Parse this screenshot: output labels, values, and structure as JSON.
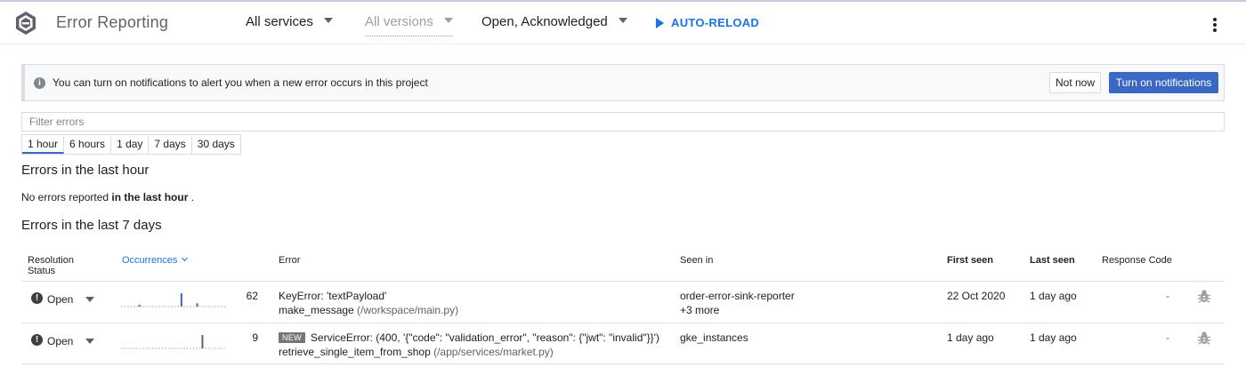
{
  "header": {
    "app_title": "Error Reporting",
    "filters": {
      "services": "All services",
      "versions": "All versions",
      "states": "Open, Acknowledged"
    },
    "auto_reload": "AUTO-RELOAD",
    "icons": {
      "logo": "error-reporting-logo",
      "menu": "more-vert-icon",
      "play": "play-icon"
    }
  },
  "banner": {
    "message": "You can turn on notifications to alert you when a new error occurs in this project",
    "not_now": "Not now",
    "turn_on": "Turn on notifications",
    "icon": "info-icon"
  },
  "filter": {
    "placeholder": "Filter errors",
    "value": ""
  },
  "time_ranges": {
    "items": [
      "1 hour",
      "6 hours",
      "1 day",
      "7 days",
      "30 days"
    ],
    "selected": "1 hour"
  },
  "last_hour": {
    "title": "Errors in the last hour",
    "empty_prefix": "No errors reported ",
    "empty_bold": "in the last hour",
    "empty_suffix": " ."
  },
  "last_7_days": {
    "title": "Errors in the last 7 days",
    "columns": {
      "resolution_1": "Resolution",
      "resolution_2": "Status",
      "occurrences": "Occurrences",
      "error": "Error",
      "seen_in": "Seen in",
      "first_seen": "First seen",
      "last_seen": "Last seen",
      "response_code": "Response Code"
    },
    "rows": [
      {
        "status": "Open",
        "count": "62",
        "badge": "",
        "title": "KeyError: 'textPayload'",
        "function": "make_message",
        "path": " (/workspace/main.py)",
        "seen_in": "order-error-sink-reporter",
        "seen_more": "+3 more",
        "first_seen": "22 Oct 2020",
        "last_seen": "1 day ago",
        "response_code": "-",
        "spark": [
          0,
          0,
          0,
          0.1,
          0,
          0,
          0,
          0,
          0,
          0,
          0,
          1,
          0,
          0,
          0.25,
          0,
          0,
          0,
          0,
          0
        ]
      },
      {
        "status": "Open",
        "count": "9",
        "badge": "NEW",
        "title": "ServiceError: (400, '{\"code\": \"validation_error\", \"reason\": {\"jwt\": \"invalid\"}}')",
        "function": "retrieve_single_item_from_shop",
        "path": " (/app/services/market.py)",
        "seen_in": "gke_instances",
        "seen_more": "",
        "first_seen": "1 day ago",
        "last_seen": "1 day ago",
        "response_code": "-",
        "spark": [
          0,
          0,
          0,
          0,
          0,
          0,
          0,
          0,
          0,
          0,
          0,
          0,
          0,
          0,
          0,
          1,
          0,
          0,
          0,
          0
        ]
      }
    ]
  },
  "colors": {
    "accent": "#1a73e8",
    "primary_button": "#3b68c2"
  }
}
